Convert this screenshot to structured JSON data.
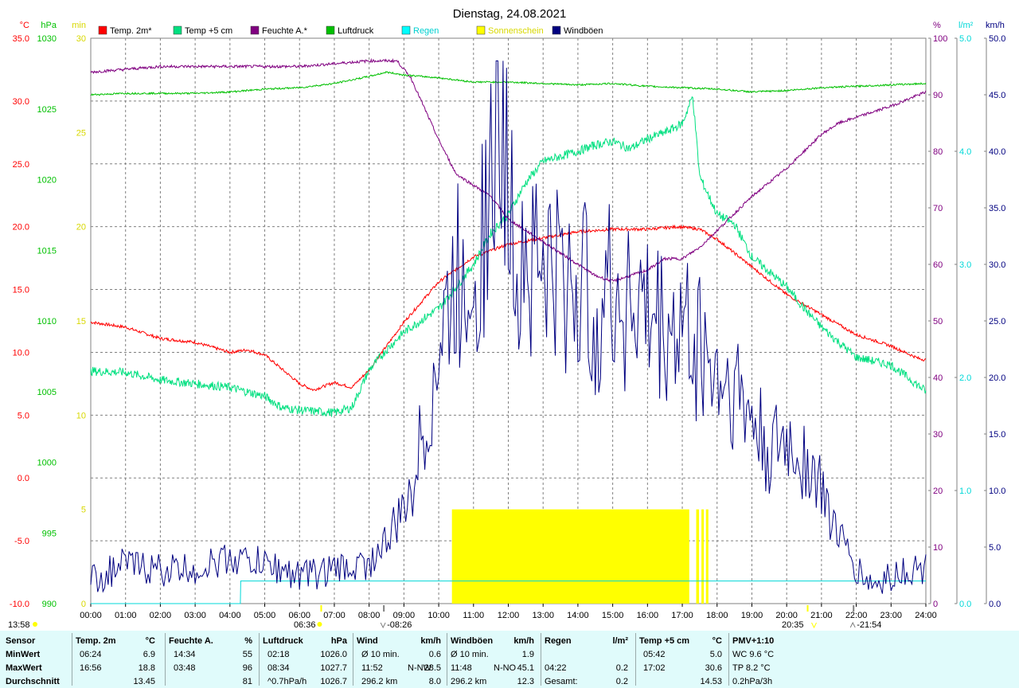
{
  "title": "Dienstag, 24.08.2021",
  "colors": {
    "temp": "#ff0000",
    "temp5": "#00e080",
    "hum": "#800080",
    "press": "#00c000",
    "rain": "#00d8d8",
    "sun": "#ffff00",
    "gust": "#000080",
    "axis_temp": "#ff0000",
    "axis_press": "#00c000",
    "axis_sun": "#d8d800",
    "axis_hum": "#800080",
    "axis_rain": "#00d8d8",
    "axis_gust": "#000080",
    "stats_bg": "#e0fbfb"
  },
  "legend": [
    {
      "label": "Temp. 2m*",
      "color": "#ff0000"
    },
    {
      "label": "Temp +5 cm",
      "color": "#00e080"
    },
    {
      "label": "Feuchte A.*",
      "color": "#800080"
    },
    {
      "label": "Luftdruck",
      "color": "#00c000"
    },
    {
      "label": "Regen",
      "color": "#00ffff"
    },
    {
      "label": "Sonnenschein",
      "color": "#ffff00"
    },
    {
      "label": "Windböen",
      "color": "#000080"
    }
  ],
  "units": {
    "temp": "°C",
    "press": "hPa",
    "sun": "min",
    "hum": "%",
    "rain": "l/m²",
    "gust": "km/h"
  },
  "chart_data": {
    "type": "line",
    "x_unit": "hour",
    "x_ticks": [
      "00:00",
      "01:00",
      "02:00",
      "03:00",
      "04:00",
      "05:00",
      "06:00",
      "07:00",
      "08:00",
      "09:00",
      "10:00",
      "11:00",
      "12:00",
      "13:00",
      "14:00",
      "15:00",
      "16:00",
      "17:00",
      "18:00",
      "19:00",
      "20:00",
      "21:00",
      "22:00",
      "23:00",
      "24:00"
    ],
    "axes": {
      "temp": {
        "range": [
          -10,
          35
        ],
        "ticks": [
          "-10.0",
          "-5.0",
          "0.0",
          "5.0",
          "10.0",
          "15.0",
          "20.0",
          "25.0",
          "30.0",
          "35.0"
        ]
      },
      "press": {
        "range": [
          990,
          1030
        ],
        "ticks": [
          "990",
          "995",
          "1000",
          "1005",
          "1010",
          "1015",
          "1020",
          "1025",
          "1030"
        ]
      },
      "sun": {
        "range": [
          0,
          30
        ],
        "ticks": [
          "0",
          "5",
          "10",
          "15",
          "20",
          "25",
          "30"
        ]
      },
      "hum": {
        "range": [
          0,
          100
        ],
        "ticks": [
          "0",
          "10",
          "20",
          "30",
          "40",
          "50",
          "60",
          "70",
          "80",
          "90",
          "100"
        ]
      },
      "rain": {
        "range": [
          0,
          5
        ],
        "ticks": [
          "0.0",
          "1.0",
          "2.0",
          "3.0",
          "4.0",
          "5.0"
        ]
      },
      "gust": {
        "range": [
          0,
          50
        ],
        "ticks": [
          "0.0",
          "5.0",
          "10.0",
          "15.0",
          "20.0",
          "25.0",
          "30.0",
          "35.0",
          "40.0",
          "45.0",
          "50.0"
        ]
      }
    },
    "series": [
      {
        "name": "Temp. 2m*",
        "axis": "temp",
        "x": [
          0,
          1,
          2,
          3,
          3.5,
          4,
          4.5,
          5,
          6,
          6.4,
          7,
          7.5,
          8,
          9,
          10,
          11,
          12,
          13,
          14,
          15,
          16,
          16.9,
          17.5,
          18,
          19,
          20,
          21,
          22,
          23,
          23.8,
          24
        ],
        "values": [
          12.4,
          12.0,
          11.1,
          10.8,
          10.4,
          10.0,
          10.2,
          9.8,
          7.5,
          7.0,
          7.6,
          7.2,
          8.6,
          12.4,
          15.6,
          17.6,
          18.6,
          19.1,
          19.6,
          19.8,
          19.8,
          20.0,
          19.8,
          19.0,
          16.8,
          14.6,
          13.0,
          11.4,
          10.5,
          9.5,
          9.4
        ]
      },
      {
        "name": "Temp +5 cm",
        "axis": "temp",
        "x": [
          0,
          1,
          2,
          3,
          4,
          5,
          5.5,
          6,
          7,
          7.5,
          8,
          8.5,
          9,
          10,
          10.5,
          11,
          11.5,
          12,
          12.5,
          13,
          14,
          14.5,
          15,
          15.5,
          16,
          16.5,
          17,
          17.3,
          17.5,
          18,
          18.5,
          19,
          20,
          20.5,
          21,
          22,
          23,
          24
        ],
        "values": [
          8.5,
          8.4,
          7.8,
          7.5,
          7.2,
          6.5,
          5.6,
          5.4,
          5.2,
          5.6,
          8.6,
          10.2,
          11.6,
          13.5,
          15.2,
          17.0,
          19.5,
          21.0,
          23.5,
          25.2,
          26.0,
          26.5,
          26.8,
          26.2,
          27.0,
          27.5,
          28.2,
          30.4,
          24.0,
          21.0,
          20.2,
          17.6,
          15.2,
          13.5,
          12.0,
          9.6,
          9.0,
          6.9
        ]
      },
      {
        "name": "Feuchte A.*",
        "axis": "hum",
        "x": [
          0,
          1,
          2,
          3,
          4,
          5,
          6,
          7,
          8,
          8.8,
          9.2,
          10,
          10.5,
          11,
          11.5,
          12,
          12.5,
          13,
          13.5,
          14,
          14.5,
          15,
          15.5,
          16,
          16.5,
          17,
          17.5,
          18,
          18.5,
          19,
          20,
          20.5,
          21,
          21.5,
          22,
          23,
          24
        ],
        "values": [
          94,
          94.5,
          95,
          95,
          95,
          95,
          95,
          95.5,
          96,
          96,
          93,
          82,
          76,
          74,
          72,
          68,
          66,
          64,
          62,
          60,
          58,
          57,
          58,
          59,
          61,
          61,
          63,
          66,
          69,
          72,
          77,
          80,
          83,
          85,
          86,
          88,
          90.5
        ]
      },
      {
        "name": "Luftdruck",
        "axis": "press",
        "x": [
          0,
          1,
          2,
          3,
          4,
          5,
          6,
          7,
          8,
          8.5,
          9,
          10,
          11,
          12,
          13,
          14,
          15,
          16,
          17,
          18,
          19,
          20,
          21,
          22,
          23,
          24
        ],
        "values": [
          1026.0,
          1026.1,
          1026.1,
          1026.1,
          1026.2,
          1026.4,
          1026.5,
          1026.8,
          1027.3,
          1027.6,
          1027.4,
          1027.2,
          1026.9,
          1026.9,
          1026.8,
          1026.7,
          1026.8,
          1026.6,
          1026.5,
          1026.4,
          1026.2,
          1026.3,
          1026.5,
          1026.6,
          1026.7,
          1026.8
        ]
      },
      {
        "name": "Regen",
        "axis": "rain",
        "x": [
          0,
          4.3,
          4.31,
          24
        ],
        "values": [
          0,
          0,
          0.2,
          0.2
        ]
      },
      {
        "name": "Windböen",
        "axis": "gust",
        "x": [
          0,
          1,
          2,
          3,
          4,
          5,
          6,
          7,
          8,
          8.5,
          9,
          9.5,
          10,
          10.5,
          11,
          11.5,
          11.8,
          12,
          12.5,
          13,
          13.5,
          14,
          14.5,
          15,
          15.5,
          16,
          16.5,
          17,
          17.5,
          18,
          18.5,
          19,
          19.5,
          20,
          20.5,
          21,
          21.5,
          22,
          22.5,
          23,
          23.5,
          24
        ],
        "values": [
          2.0,
          3.5,
          3.0,
          3.0,
          4.0,
          3.5,
          2.5,
          3.0,
          3.5,
          5.5,
          8.0,
          14.0,
          22.0,
          28.0,
          30.0,
          36.0,
          45.1,
          34.0,
          31.0,
          30.0,
          28.0,
          28.0,
          26.0,
          27.0,
          27.0,
          25.0,
          24.0,
          24.0,
          23.0,
          20.0,
          19.0,
          16.0,
          13.0,
          14.0,
          13.0,
          10.0,
          6.0,
          3.0,
          1.5,
          2.5,
          3.0,
          3.0
        ]
      }
    ],
    "sunshine": [
      {
        "start": 10.38,
        "end": 17.2
      },
      {
        "start": 17.4,
        "end": 17.48
      },
      {
        "start": 17.55,
        "end": 17.62
      },
      {
        "start": 17.68,
        "end": 17.75
      }
    ],
    "sun_level": 5,
    "markers": {
      "sunrise": "06:36",
      "sunset": "20:35",
      "moon1": "-08:26",
      "moon2": "-21:54",
      "corner_time": "13:58"
    }
  },
  "stats": [
    {
      "header": "Sensor",
      "unit": "",
      "rows": [
        {
          "a": "MinWert",
          "b": "",
          "v": ""
        },
        {
          "a": "MaxWert",
          "b": "",
          "v": ""
        },
        {
          "a": "Durchschnitt",
          "b": "",
          "v": ""
        }
      ]
    },
    {
      "header": "Temp. 2m",
      "unit": "°C",
      "rows": [
        {
          "a": "06:24",
          "b": "",
          "v": "6.9"
        },
        {
          "a": "16:56",
          "b": "",
          "v": "18.8"
        },
        {
          "a": "",
          "b": "",
          "v": "13.45"
        }
      ]
    },
    {
      "header": "Feuchte A.",
      "unit": "%",
      "rows": [
        {
          "a": "14:34",
          "b": "",
          "v": "55"
        },
        {
          "a": "03:48",
          "b": "",
          "v": "96"
        },
        {
          "a": "",
          "b": "",
          "v": "81"
        }
      ]
    },
    {
      "header": "Luftdruck",
      "unit": "hPa",
      "rows": [
        {
          "a": "02:18",
          "b": "",
          "v": "1026.0"
        },
        {
          "a": "08:34",
          "b": "",
          "v": "1027.7"
        },
        {
          "a": "^0.7hPa/h",
          "b": "",
          "v": "1026.7"
        }
      ]
    },
    {
      "header": "Wind",
      "unit": "km/h",
      "rows": [
        {
          "a": "Ø 10 min.",
          "b": "",
          "v": "0.6"
        },
        {
          "a": "11:52",
          "b": "N-NW",
          "v": "28.5"
        },
        {
          "a": "296.2 km",
          "b": "",
          "v": "8.0"
        }
      ]
    },
    {
      "header": "Windböen",
      "unit": "km/h",
      "rows": [
        {
          "a": "Ø 10 min.",
          "b": "",
          "v": "1.9"
        },
        {
          "a": "11:48",
          "b": "N-NO",
          "v": "45.1"
        },
        {
          "a": "296.2 km",
          "b": "",
          "v": "12.3"
        }
      ]
    },
    {
      "header": "Regen",
      "unit": "l/m²",
      "rows": [
        {
          "a": "",
          "b": "",
          "v": ""
        },
        {
          "a": "04:22",
          "b": "",
          "v": "0.2"
        },
        {
          "a": "Gesamt:",
          "b": "",
          "v": "0.2"
        }
      ]
    },
    {
      "header": "Temp +5 cm",
      "unit": "°C",
      "rows": [
        {
          "a": "05:42",
          "b": "",
          "v": "5.0"
        },
        {
          "a": "17:02",
          "b": "",
          "v": "30.6"
        },
        {
          "a": "",
          "b": "",
          "v": "14.53"
        }
      ]
    },
    {
      "header": "PMV+1:10",
      "unit": "",
      "rows": [
        {
          "a": "WC 9.6 °C",
          "b": "",
          "v": ""
        },
        {
          "a": "TP 8.2 °C",
          "b": "",
          "v": ""
        },
        {
          "a": "0.2hPa/3h",
          "b": "",
          "v": ""
        }
      ]
    }
  ]
}
